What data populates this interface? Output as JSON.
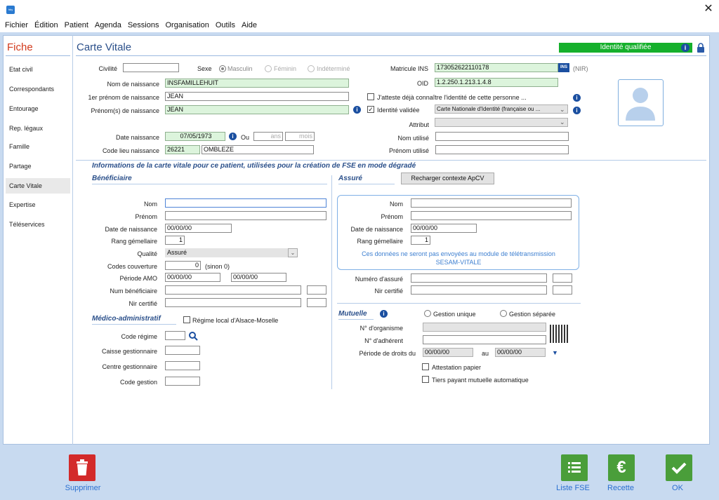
{
  "window": {
    "icon_text": "hby",
    "close": "✕"
  },
  "menu": [
    "Fichier",
    "Édition",
    "Patient",
    "Agenda",
    "Sessions",
    "Organisation",
    "Outils",
    "Aide"
  ],
  "sidebar": {
    "title": "Fiche",
    "items": [
      "Etat civil",
      "Correspondants",
      "Entourage",
      "Rep. légaux",
      "Famille",
      "Partage",
      "Carte Vitale",
      "Expertise",
      "Téléservices"
    ],
    "active": "Carte Vitale"
  },
  "header": {
    "title": "Carte Vitale",
    "identity_badge": "Identité qualifiée",
    "colors": {
      "badge": "#15b02c",
      "accent": "#2a4f8a",
      "fiche": "#d23a1c"
    }
  },
  "identity": {
    "civilite_label": "Civilité",
    "civilite_value": "",
    "sexe_label": "Sexe",
    "sexe_options": [
      "Masculin",
      "Féminin",
      "Indéterminé"
    ],
    "sexe_selected": "Masculin",
    "matricule_label": "Matricule INS",
    "matricule_value": "173052622110178",
    "ins_badge": "INS",
    "nir_label": "(NIR)",
    "oid_label": "OID",
    "oid_value": "1.2.250.1.213.1.4.8",
    "nom_naissance_label": "Nom de naissance",
    "nom_naissance_value": "INSFAMILLEHUIT",
    "premier_prenom_label": "1er prénom de naissance",
    "premier_prenom_value": "JEAN",
    "atteste_label": "J'atteste déjà connaître l'identité de cette personne ...",
    "prenoms_label": "Prénom(s) de naissance",
    "prenoms_value": "JEAN",
    "identite_validee_label": "Identité validée",
    "identite_validee_checked": "✓",
    "piece_value": "Carte Nationale d'Identité (française ou ...",
    "attribut_label": "Attribut",
    "attribut_value": "",
    "date_naissance_label": "Date naissance",
    "date_naissance_value": "07/05/1973",
    "ou_label": "Ou",
    "ans_placeholder": "ans",
    "mois_placeholder": "mois",
    "nom_utilise_label": "Nom utilisé",
    "nom_utilise_value": "",
    "code_lieu_label": "Code lieu naissance",
    "code_lieu_value": "26221",
    "lieu_value": "OMBLEZE",
    "prenom_utilise_label": "Prénom utilisé",
    "prenom_utilise_value": ""
  },
  "cv": {
    "info_title": "Informations de la carte vitale pour ce patient, utilisées pour la création de FSE en mode dégradé",
    "beneficiaire": {
      "title": "Bénéficiaire",
      "nom_label": "Nom",
      "nom_value": "",
      "prenom_label": "Prénom",
      "prenom_value": "",
      "ddn_label": "Date de naissance",
      "ddn_value": "00/00/00",
      "rang_label": "Rang gémellaire",
      "rang_value": "1",
      "qualite_label": "Qualité",
      "qualite_value": "Assuré",
      "codes_couverture_label": "Codes couverture",
      "codes_couverture_value": "0",
      "sinon_label": "(sinon 0)",
      "periode_amo_label": "Période AMO",
      "periode_amo_from": "00/00/00",
      "periode_amo_to": "00/00/00",
      "num_benef_label": "Num bénéficiaire",
      "num_benef_value": "",
      "nir_certifie_label": "Nir certifié",
      "nir_certifie_value": ""
    },
    "medico": {
      "title": "Médico-administratif",
      "alsace_label": "Régime local d'Alsace-Moselle",
      "code_regime_label": "Code régime",
      "code_regime_value": "",
      "caisse_label": "Caisse gestionnaire",
      "caisse_value": "",
      "centre_label": "Centre gestionnaire",
      "centre_value": "",
      "code_gestion_label": "Code gestion",
      "code_gestion_value": ""
    },
    "assure": {
      "title": "Assuré",
      "recharger_label": "Recharger contexte ApCV",
      "nom_label": "Nom",
      "nom_value": "",
      "prenom_label": "Prénom",
      "prenom_value": "",
      "ddn_label": "Date de naissance",
      "ddn_value": "00/00/00",
      "rang_label": "Rang gémellaire",
      "rang_value": "1",
      "note": "Ces données ne seront pas envoyées au module de télétransmission SESAM-VITALE",
      "numero_label": "Numéro d'assuré",
      "numero_value": "",
      "nir_certifie_label": "Nir certifié",
      "nir_certifie_value": ""
    },
    "mutuelle": {
      "title": "Mutuelle",
      "gestion_unique_label": "Gestion unique",
      "gestion_separee_label": "Gestion séparée",
      "organisme_label": "N° d'organisme",
      "organisme_value": "",
      "adherent_label": "N° d'adhérent",
      "adherent_value": "",
      "periode_label": "Période de droits du",
      "periode_from": "00/00/00",
      "au_label": "au",
      "periode_to": "00/00/00",
      "attestation_label": "Attestation papier",
      "tiers_payant_label": "Tiers payant mutuelle automatique"
    }
  },
  "footer": {
    "supprimer": "Supprimer",
    "liste_fse": "Liste FSE",
    "recette": "Recette",
    "ok": "OK",
    "colors": {
      "supprimer": "#d32a2a",
      "green": "#4a9e3a"
    }
  }
}
